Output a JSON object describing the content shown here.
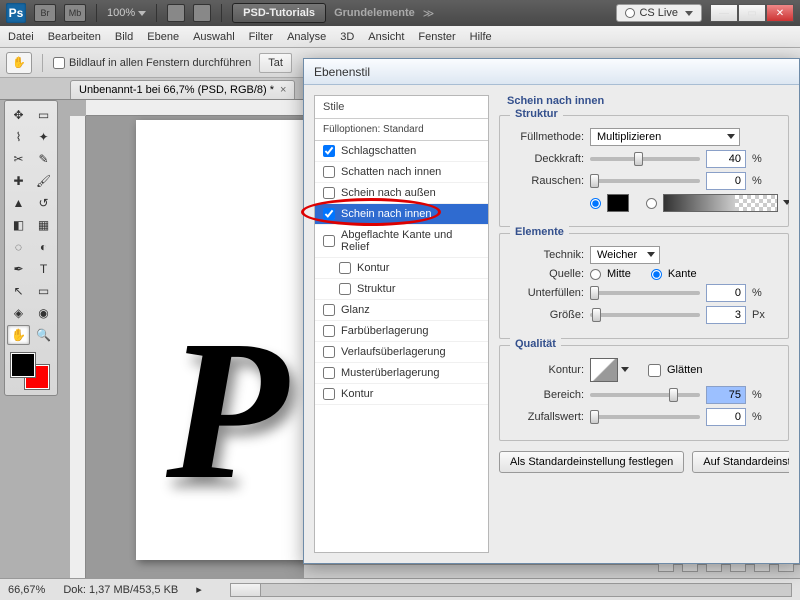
{
  "topbar": {
    "logo": "Ps",
    "buttons": [
      "Br",
      "Mb"
    ],
    "zoom": "100%",
    "psd_tut": "PSD-Tutorials",
    "grund": "Grundelemente",
    "cslive": "CS Live"
  },
  "menu": [
    "Datei",
    "Bearbeiten",
    "Bild",
    "Ebene",
    "Auswahl",
    "Filter",
    "Analyse",
    "3D",
    "Ansicht",
    "Fenster",
    "Hilfe"
  ],
  "optbar": {
    "scroll_all": "Bildlauf in allen Fenstern durchführen",
    "tat": "Tat"
  },
  "doctab": {
    "label": "Unbenannt-1 bei 66,7% (PSD, RGB/8) *"
  },
  "status": {
    "zoom": "66,67%",
    "dok": "Dok: 1,37 MB/453,5 KB"
  },
  "dialog": {
    "title": "Ebenenstil",
    "stile": "Stile",
    "fullopt": "Fülloptionen: Standard",
    "items": [
      {
        "label": "Schlagschatten",
        "checked": true
      },
      {
        "label": "Schatten nach innen",
        "checked": false
      },
      {
        "label": "Schein nach außen",
        "checked": false
      },
      {
        "label": "Schein nach innen",
        "checked": true,
        "selected": true
      },
      {
        "label": "Abgeflachte Kante und Relief",
        "checked": false
      },
      {
        "label": "Kontur",
        "checked": false,
        "indent": true
      },
      {
        "label": "Struktur",
        "checked": false,
        "indent": true
      },
      {
        "label": "Glanz",
        "checked": false
      },
      {
        "label": "Farbüberlagerung",
        "checked": false
      },
      {
        "label": "Verlaufsüberlagerung",
        "checked": false
      },
      {
        "label": "Musterüberlagerung",
        "checked": false
      },
      {
        "label": "Kontur",
        "checked": false
      }
    ],
    "panel_title": "Schein nach innen",
    "struktur": {
      "legend": "Struktur",
      "fill_label": "Füllmethode:",
      "fill_value": "Multiplizieren",
      "deck_label": "Deckkraft:",
      "deck_value": "40",
      "rauschen_label": "Rauschen:",
      "rauschen_value": "0",
      "pct": "%"
    },
    "elemente": {
      "legend": "Elemente",
      "technik_label": "Technik:",
      "technik_value": "Weicher",
      "quelle_label": "Quelle:",
      "mitte": "Mitte",
      "kante": "Kante",
      "unterf_label": "Unterfüllen:",
      "unterf_value": "0",
      "groesse_label": "Größe:",
      "groesse_value": "3",
      "px": "Px",
      "pct": "%"
    },
    "qualitaet": {
      "legend": "Qualität",
      "kontur_label": "Kontur:",
      "glaetten": "Glätten",
      "bereich_label": "Bereich:",
      "bereich_value": "75",
      "zufall_label": "Zufallswert:",
      "zufall_value": "0",
      "pct": "%"
    },
    "btn_standard": "Als Standardeinstellung festlegen",
    "btn_reset": "Auf Standardeinstellun"
  }
}
